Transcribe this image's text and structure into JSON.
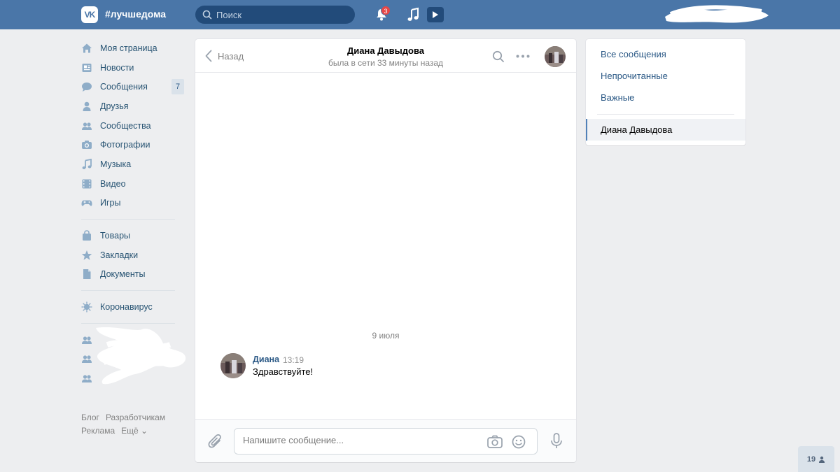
{
  "header": {
    "logo_text": "VK",
    "hashtag": "#лучшедома",
    "search_placeholder": "Поиск",
    "notifications_count": "3"
  },
  "nav": {
    "items": [
      {
        "label": "Моя страница",
        "icon": "home-icon"
      },
      {
        "label": "Новости",
        "icon": "news-icon"
      },
      {
        "label": "Сообщения",
        "icon": "messages-icon",
        "count": "7"
      },
      {
        "label": "Друзья",
        "icon": "friend-icon"
      },
      {
        "label": "Сообщества",
        "icon": "groups-icon"
      },
      {
        "label": "Фотографии",
        "icon": "camera-icon"
      },
      {
        "label": "Музыка",
        "icon": "music-icon"
      },
      {
        "label": "Видео",
        "icon": "video-icon"
      },
      {
        "label": "Игры",
        "icon": "gamepad-icon"
      }
    ],
    "items2": [
      {
        "label": "Товары",
        "icon": "bag-icon"
      },
      {
        "label": "Закладки",
        "icon": "star-icon"
      },
      {
        "label": "Документы",
        "icon": "document-icon"
      }
    ],
    "items3": [
      {
        "label": "Коронавирус",
        "icon": "virus-icon"
      }
    ],
    "groups": [
      {
        "label": "",
        "icon": "group-icon"
      },
      {
        "label": "",
        "icon": "group-icon"
      },
      {
        "label": "",
        "icon": "group-icon"
      }
    ],
    "footer": {
      "blog": "Блог",
      "developers": "Разработчикам",
      "ads": "Реклама",
      "more": "Ещё ⌄"
    }
  },
  "chat": {
    "back_label": "Назад",
    "peer_name": "Диана Давыдова",
    "peer_status": "была в сети 33 минуты назад",
    "date_separator": "9 июля",
    "messages": [
      {
        "author": "Диана",
        "time": "13:19",
        "text": "Здравствуйте!"
      }
    ],
    "composer_placeholder": "Напишите сообщение..."
  },
  "right_panel": {
    "all": "Все сообщения",
    "unread": "Непрочитанные",
    "important": "Важные",
    "active_dialog": "Диана Давыдова"
  },
  "online_count": "19",
  "colors": {
    "header": "#4a76a8",
    "link": "#2a5885",
    "background": "#edeef0",
    "badge": "#e64646"
  }
}
